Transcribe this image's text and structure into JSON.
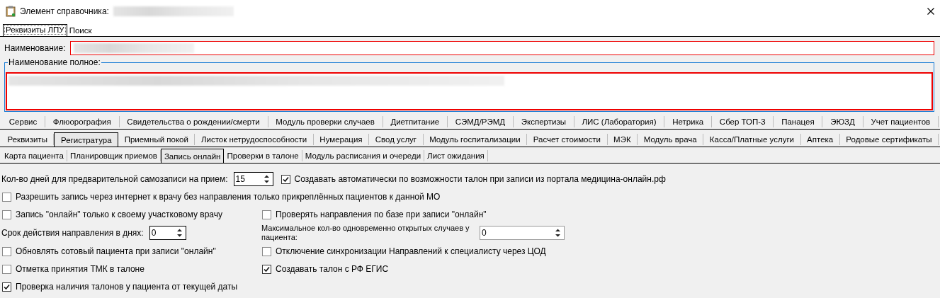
{
  "window": {
    "title": "Элемент справочника:"
  },
  "main_tabs": [
    {
      "label": "Реквизиты ЛПУ",
      "selected": true
    },
    {
      "label": "Поиск",
      "selected": false
    }
  ],
  "name_field": {
    "label": "Наименование:"
  },
  "full_name_group": {
    "label": "Наименование полное:"
  },
  "section_tabs": [
    {
      "label": "Сервис",
      "selected": false
    },
    {
      "label": "Флюорография",
      "selected": false
    },
    {
      "label": "Свидетельства о рождении/смерти",
      "selected": false
    },
    {
      "label": "Модуль проверки случаев",
      "selected": false
    },
    {
      "label": "Диетпитание",
      "selected": false
    },
    {
      "label": "СЭМД/РЭМД",
      "selected": false
    },
    {
      "label": "Экспертизы",
      "selected": false
    },
    {
      "label": "ЛИС (Лаборатория)",
      "selected": false
    },
    {
      "label": "Нетрика",
      "selected": false
    },
    {
      "label": "Сбер ТОП-3",
      "selected": false
    },
    {
      "label": "Панацея",
      "selected": false
    },
    {
      "label": "ЭЮЗД",
      "selected": false
    },
    {
      "label": "Учет пациентов",
      "selected": false
    }
  ],
  "module_tabs": [
    {
      "label": "Реквизиты",
      "selected": false
    },
    {
      "label": "Регистратура",
      "selected": true
    },
    {
      "label": "Приемный покой",
      "selected": false
    },
    {
      "label": "Листок нетрудоспособности",
      "selected": false
    },
    {
      "label": "Нумерация",
      "selected": false
    },
    {
      "label": "Свод услуг",
      "selected": false
    },
    {
      "label": "Модуль госпитализации",
      "selected": false
    },
    {
      "label": "Расчет стоимости",
      "selected": false
    },
    {
      "label": "МЭК",
      "selected": false
    },
    {
      "label": "Модуль врача",
      "selected": false
    },
    {
      "label": "Касса/Платные услуги",
      "selected": false
    },
    {
      "label": "Аптека",
      "selected": false
    },
    {
      "label": "Родовые сертификаты",
      "selected": false
    }
  ],
  "subtabs": [
    {
      "label": "Карта пациента",
      "selected": false
    },
    {
      "label": "Планировщик приемов",
      "selected": false
    },
    {
      "label": "Запись онлайн",
      "selected": true
    },
    {
      "label": "Проверки в талоне",
      "selected": false
    },
    {
      "label": "Модуль расписания и очереди",
      "selected": false
    },
    {
      "label": "Лист ожидания",
      "selected": false
    }
  ],
  "settings": [
    {
      "left": {
        "kind": "spin",
        "label": "Кол-во дней для предварительной самозаписи на прием:",
        "value": "15"
      },
      "right": {
        "kind": "checkbox",
        "label": "Создавать автоматически по возможности талон при записи из портала медицина-онлайн.рф",
        "checked": true
      }
    },
    {
      "left": {
        "kind": "checkbox",
        "label": "Разрешить запись через интернет к врачу без направления только прикреплённых пациентов к данной МО",
        "checked": false
      }
    },
    {
      "left": {
        "kind": "checkbox",
        "label": "Запись \"онлайн\" только к своему участковому врачу",
        "checked": false
      },
      "right": {
        "kind": "checkbox",
        "label": "Проверять направления по базе при записи \"онлайн\"",
        "checked": false
      }
    },
    {
      "left": {
        "kind": "spin",
        "label": "Срок действия направления в днях:",
        "value": "0"
      },
      "right": {
        "kind": "spin_small",
        "label": "Максимальное кол-во одновременно открытых случаев у пациента:",
        "value": "0"
      }
    },
    {
      "left": {
        "kind": "checkbox",
        "label": "Обновлять сотовый пациента при записи \"онлайн\"",
        "checked": false
      },
      "right": {
        "kind": "checkbox",
        "label": "Отключение синхронизации Направлений к специалисту через ЦОД",
        "checked": false
      }
    },
    {
      "left": {
        "kind": "checkbox",
        "label": "Отметка принятия ТМК в талоне",
        "checked": false
      },
      "right": {
        "kind": "checkbox",
        "label": "Создавать талон с РФ ЕГИС",
        "checked": true
      }
    },
    {
      "left": {
        "kind": "checkbox",
        "label": "Проверка наличия талонов у пациента от текущей даты",
        "checked": true
      }
    }
  ]
}
